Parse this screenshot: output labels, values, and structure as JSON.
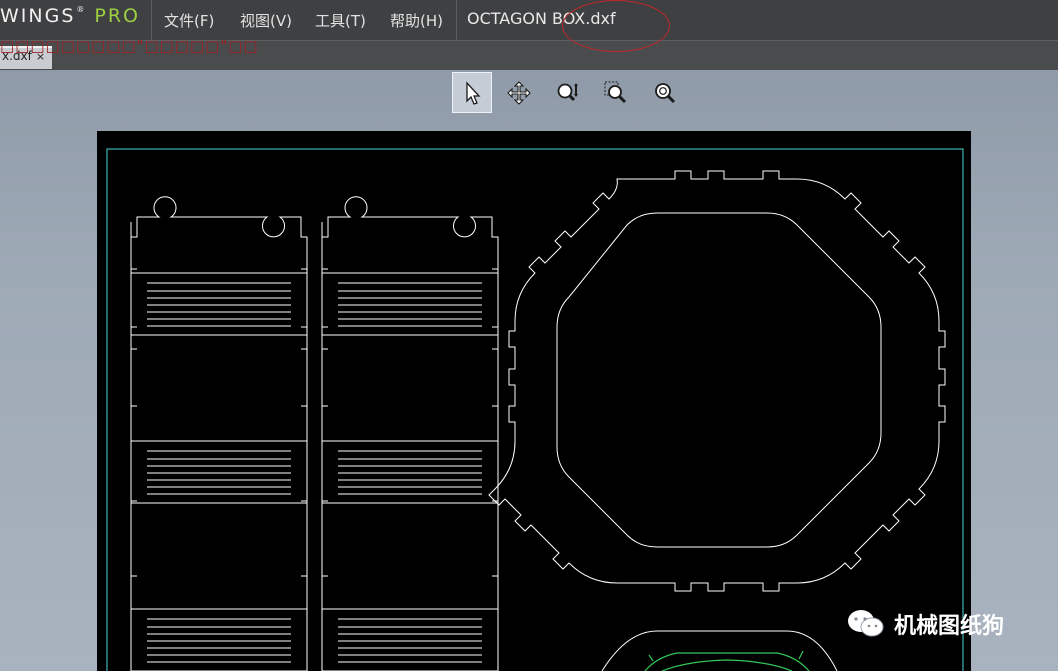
{
  "app": {
    "brand_main": "WINGS",
    "brand_mark": "®",
    "brand_suffix": "PRO",
    "document_title": "OCTAGON BOX.dxf"
  },
  "menu": {
    "items": [
      {
        "label": "文件(F)"
      },
      {
        "label": "视图(V)"
      },
      {
        "label": "工具(T)"
      },
      {
        "label": "帮助(H)"
      }
    ]
  },
  "overlay_note": "□□□□□□□□□\"□□□□□\"□□",
  "tab": {
    "label": "x.dxf",
    "close_glyph": "×"
  },
  "toolbar": {
    "tools": [
      {
        "name": "select",
        "active": true
      },
      {
        "name": "pan",
        "active": false
      },
      {
        "name": "zoom",
        "active": false
      },
      {
        "name": "zoom-window",
        "active": false
      },
      {
        "name": "zoom-extents",
        "active": false
      }
    ]
  },
  "watermark": {
    "text": "机械图纸狗"
  },
  "colors": {
    "menubar_bg": "#3f4042",
    "brand_accent": "#9ccf42",
    "annotation_red": "#c0282b",
    "canvas_bg": "#000000",
    "border_cyan": "#4fd3d3",
    "drawing_lines": "#ffffff",
    "drawing_green": "#34c759"
  }
}
